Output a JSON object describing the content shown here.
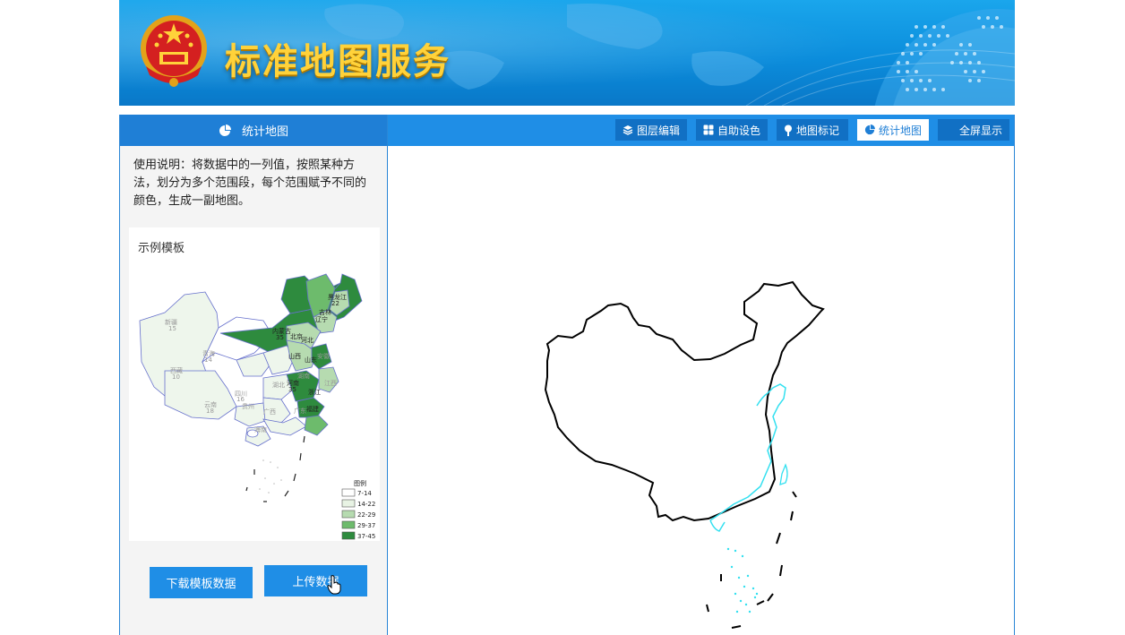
{
  "banner": {
    "title": "标准地图服务"
  },
  "sidebar": {
    "header": "统计地图",
    "description": "使用说明：将数据中的一列值，按照某种方法，划分为多个范围段，每个范围赋予不同的颜色，生成一副地图。",
    "template_title": "示例模板",
    "legend": {
      "title": "图例",
      "ranges": [
        "7-14",
        "14-22",
        "22-29",
        "29-37",
        "37-45"
      ],
      "colors": [
        "#ffffff",
        "#e8f3e4",
        "#b6dbb0",
        "#6dbb6c",
        "#2e8b3e"
      ]
    },
    "download_button": "下载模板数据",
    "upload_button": "上传数据"
  },
  "toolbar": {
    "items": [
      {
        "label": "图层编辑",
        "icon": "layers-icon"
      },
      {
        "label": "自助设色",
        "icon": "grid-icon"
      },
      {
        "label": "地图标记",
        "icon": "pin-icon"
      },
      {
        "label": "统计地图",
        "icon": "pie-chart-icon"
      },
      {
        "label": "全屏显示",
        "icon": "fullscreen-icon"
      }
    ],
    "active": "统计地图"
  },
  "colors": {
    "accent": "#1f8ee6",
    "header_dark": "#1f7fd6",
    "coast": "#33e0f0",
    "border": "#000000"
  }
}
